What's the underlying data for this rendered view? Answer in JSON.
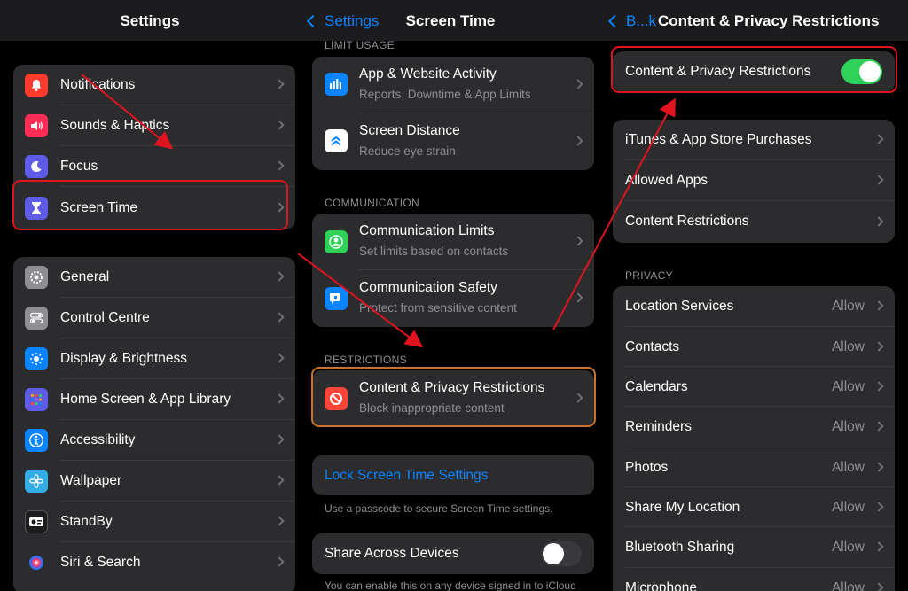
{
  "settings": {
    "title": "Settings",
    "group1": [
      {
        "label": "Notifications",
        "icon": "bell-icon",
        "color": "#ff3b30"
      },
      {
        "label": "Sounds & Haptics",
        "icon": "speaker-icon",
        "color": "#ff2d55"
      },
      {
        "label": "Focus",
        "icon": "moon-icon",
        "color": "#5e5ce6"
      },
      {
        "label": "Screen Time",
        "icon": "hourglass-icon",
        "color": "#5e5ce6"
      }
    ],
    "group2": [
      {
        "label": "General",
        "icon": "gear-icon",
        "color": "#8e8e93"
      },
      {
        "label": "Control Centre",
        "icon": "switches-icon",
        "color": "#8e8e93"
      },
      {
        "label": "Display & Brightness",
        "icon": "sun-icon",
        "color": "#0a84ff"
      },
      {
        "label": "Home Screen & App Library",
        "icon": "grid-icon",
        "color": "#5e5ce6"
      },
      {
        "label": "Accessibility",
        "icon": "accessibility-icon",
        "color": "#0a84ff"
      },
      {
        "label": "Wallpaper",
        "icon": "flower-icon",
        "color": "#32ade6"
      },
      {
        "label": "StandBy",
        "icon": "standby-icon",
        "color": "#1c1c1e"
      },
      {
        "label": "Siri & Search",
        "icon": "siri-icon",
        "color": "#2c2c2e"
      }
    ]
  },
  "screen_time": {
    "back": "Settings",
    "title": "Screen Time",
    "limit_usage_header": "LIMIT USAGE",
    "limit_usage": [
      {
        "label": "App & Website Activity",
        "sub": "Reports, Downtime & App Limits",
        "icon": "chart-icon",
        "color": "#0a84ff"
      },
      {
        "label": "Screen Distance",
        "sub": "Reduce eye strain",
        "icon": "chevrons-up-icon",
        "color": "#ffffff"
      }
    ],
    "communication_header": "COMMUNICATION",
    "communication": [
      {
        "label": "Communication Limits",
        "sub": "Set limits based on contacts",
        "icon": "person-icon",
        "color": "#30d158"
      },
      {
        "label": "Communication Safety",
        "sub": "Protect from sensitive content",
        "icon": "bubble-icon",
        "color": "#0a84ff"
      }
    ],
    "restrictions_header": "RESTRICTIONS",
    "restrictions": [
      {
        "label": "Content & Privacy Restrictions",
        "sub": "Block inappropriate content",
        "icon": "prohibited-icon",
        "color": "#ff453a"
      }
    ],
    "lock_label": "Lock Screen Time Settings",
    "lock_note": "Use a passcode to secure Screen Time settings.",
    "share_label": "Share Across Devices",
    "share_note": "You can enable this on any device signed in to iCloud"
  },
  "content_privacy": {
    "back": "B...k",
    "title": "Content & Privacy Restrictions",
    "toggle_label": "Content & Privacy Restrictions",
    "toggle_on": true,
    "store_group": [
      {
        "label": "iTunes & App Store Purchases"
      },
      {
        "label": "Allowed Apps"
      },
      {
        "label": "Content Restrictions"
      }
    ],
    "privacy_header": "PRIVACY",
    "privacy": [
      {
        "label": "Location Services",
        "value": "Allow"
      },
      {
        "label": "Contacts",
        "value": "Allow"
      },
      {
        "label": "Calendars",
        "value": "Allow"
      },
      {
        "label": "Reminders",
        "value": "Allow"
      },
      {
        "label": "Photos",
        "value": "Allow"
      },
      {
        "label": "Share My Location",
        "value": "Allow"
      },
      {
        "label": "Bluetooth Sharing",
        "value": "Allow"
      },
      {
        "label": "Microphone",
        "value": "Allow"
      }
    ]
  },
  "colors": {
    "accent": "#0a84ff",
    "highlight": "#e0141e",
    "toggle_on": "#30d158"
  }
}
